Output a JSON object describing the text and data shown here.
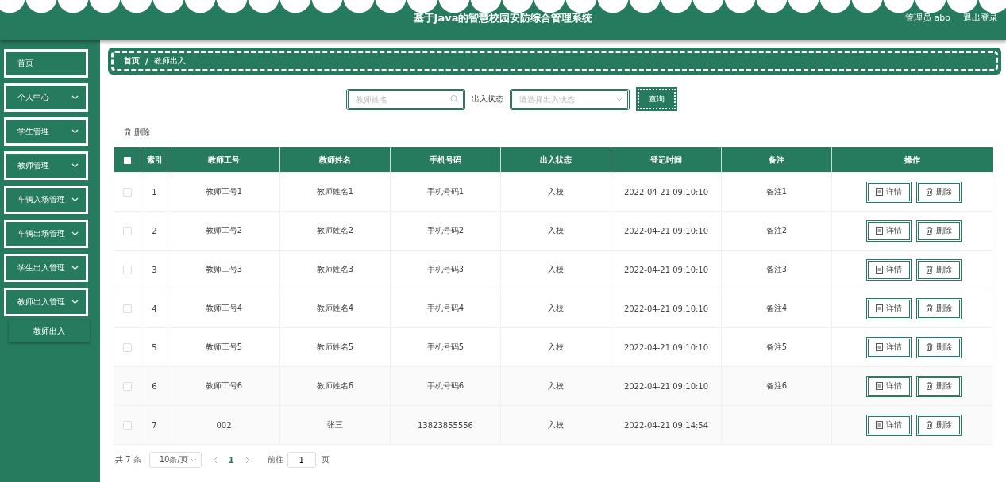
{
  "header": {
    "title": "基于Java的智慧校园安防综合管理系统",
    "user": "管理员 abo",
    "logout": "退出登录"
  },
  "sidebar": {
    "items": [
      {
        "label": "首页",
        "kind": "link"
      },
      {
        "label": "个人中心",
        "kind": "submenu"
      },
      {
        "label": "学生管理",
        "kind": "submenu"
      },
      {
        "label": "教师管理",
        "kind": "submenu"
      },
      {
        "label": "车辆入场管理",
        "kind": "submenu"
      },
      {
        "label": "车辆出场管理",
        "kind": "submenu"
      },
      {
        "label": "学生出入管理",
        "kind": "submenu"
      },
      {
        "label": "教师出入管理",
        "kind": "submenu",
        "children": [
          {
            "label": "教师出入"
          }
        ]
      }
    ]
  },
  "breadcrumb": [
    "首页",
    "教师出入"
  ],
  "breadcrumb_separator": "/",
  "search": {
    "name_placeholder": "教师姓名",
    "status_label": "出入状态",
    "status_placeholder": "请选择出入状态",
    "button": "查询"
  },
  "delete_button": "删除",
  "table": {
    "select_all": {
      "checked": false
    },
    "columns": [
      "索引",
      "教师工号",
      "教师姓名",
      "手机号码",
      "出入状态",
      "登记时间",
      "备注",
      "操作"
    ],
    "rows": [
      {
        "checked": false,
        "index": "1",
        "id": "教师工号1",
        "name": "教师姓名1",
        "phone": "手机号码1",
        "status": "入校",
        "time": "2022-04-21 09:10:10",
        "note": "备注1",
        "actions": [
          "详情",
          "删除"
        ]
      },
      {
        "checked": false,
        "index": "2",
        "id": "教师工号2",
        "name": "教师姓名2",
        "phone": "手机号码2",
        "status": "入校",
        "time": "2022-04-21 09:10:10",
        "note": "备注2",
        "actions": [
          "详情",
          "删除"
        ]
      },
      {
        "checked": false,
        "index": "3",
        "id": "教师工号3",
        "name": "教师姓名3",
        "phone": "手机号码3",
        "status": "入校",
        "time": "2022-04-21 09:10:10",
        "note": "备注3",
        "actions": [
          "详情",
          "删除"
        ]
      },
      {
        "checked": false,
        "index": "4",
        "id": "教师工号4",
        "name": "教师姓名4",
        "phone": "手机号码4",
        "status": "入校",
        "time": "2022-04-21 09:10:10",
        "note": "备注4",
        "actions": [
          "详情",
          "删除"
        ]
      },
      {
        "checked": false,
        "index": "5",
        "id": "教师工号5",
        "name": "教师姓名5",
        "phone": "手机号码5",
        "status": "入校",
        "time": "2022-04-21 09:10:10",
        "note": "备注5",
        "actions": [
          "详情",
          "删除"
        ]
      },
      {
        "checked": false,
        "index": "6",
        "id": "教师工号6",
        "name": "教师姓名6",
        "phone": "手机号码6",
        "status": "入校",
        "time": "2022-04-21 09:10:10",
        "note": "备注6",
        "actions": [
          "详情",
          "删除"
        ]
      },
      {
        "checked": false,
        "index": "7",
        "id": "002",
        "name": "张三",
        "phone": "13823855556",
        "status": "入校",
        "time": "2022-04-21 09:14:54",
        "actions": [
          "详情",
          "删除"
        ]
      }
    ]
  },
  "pagination": {
    "total": "共 7 条",
    "page_size": "10条/页",
    "pages": [
      {
        "label": "1",
        "selected": true
      }
    ],
    "goto_label": "前往",
    "goto_value": "1",
    "goto_suffix": "页"
  }
}
